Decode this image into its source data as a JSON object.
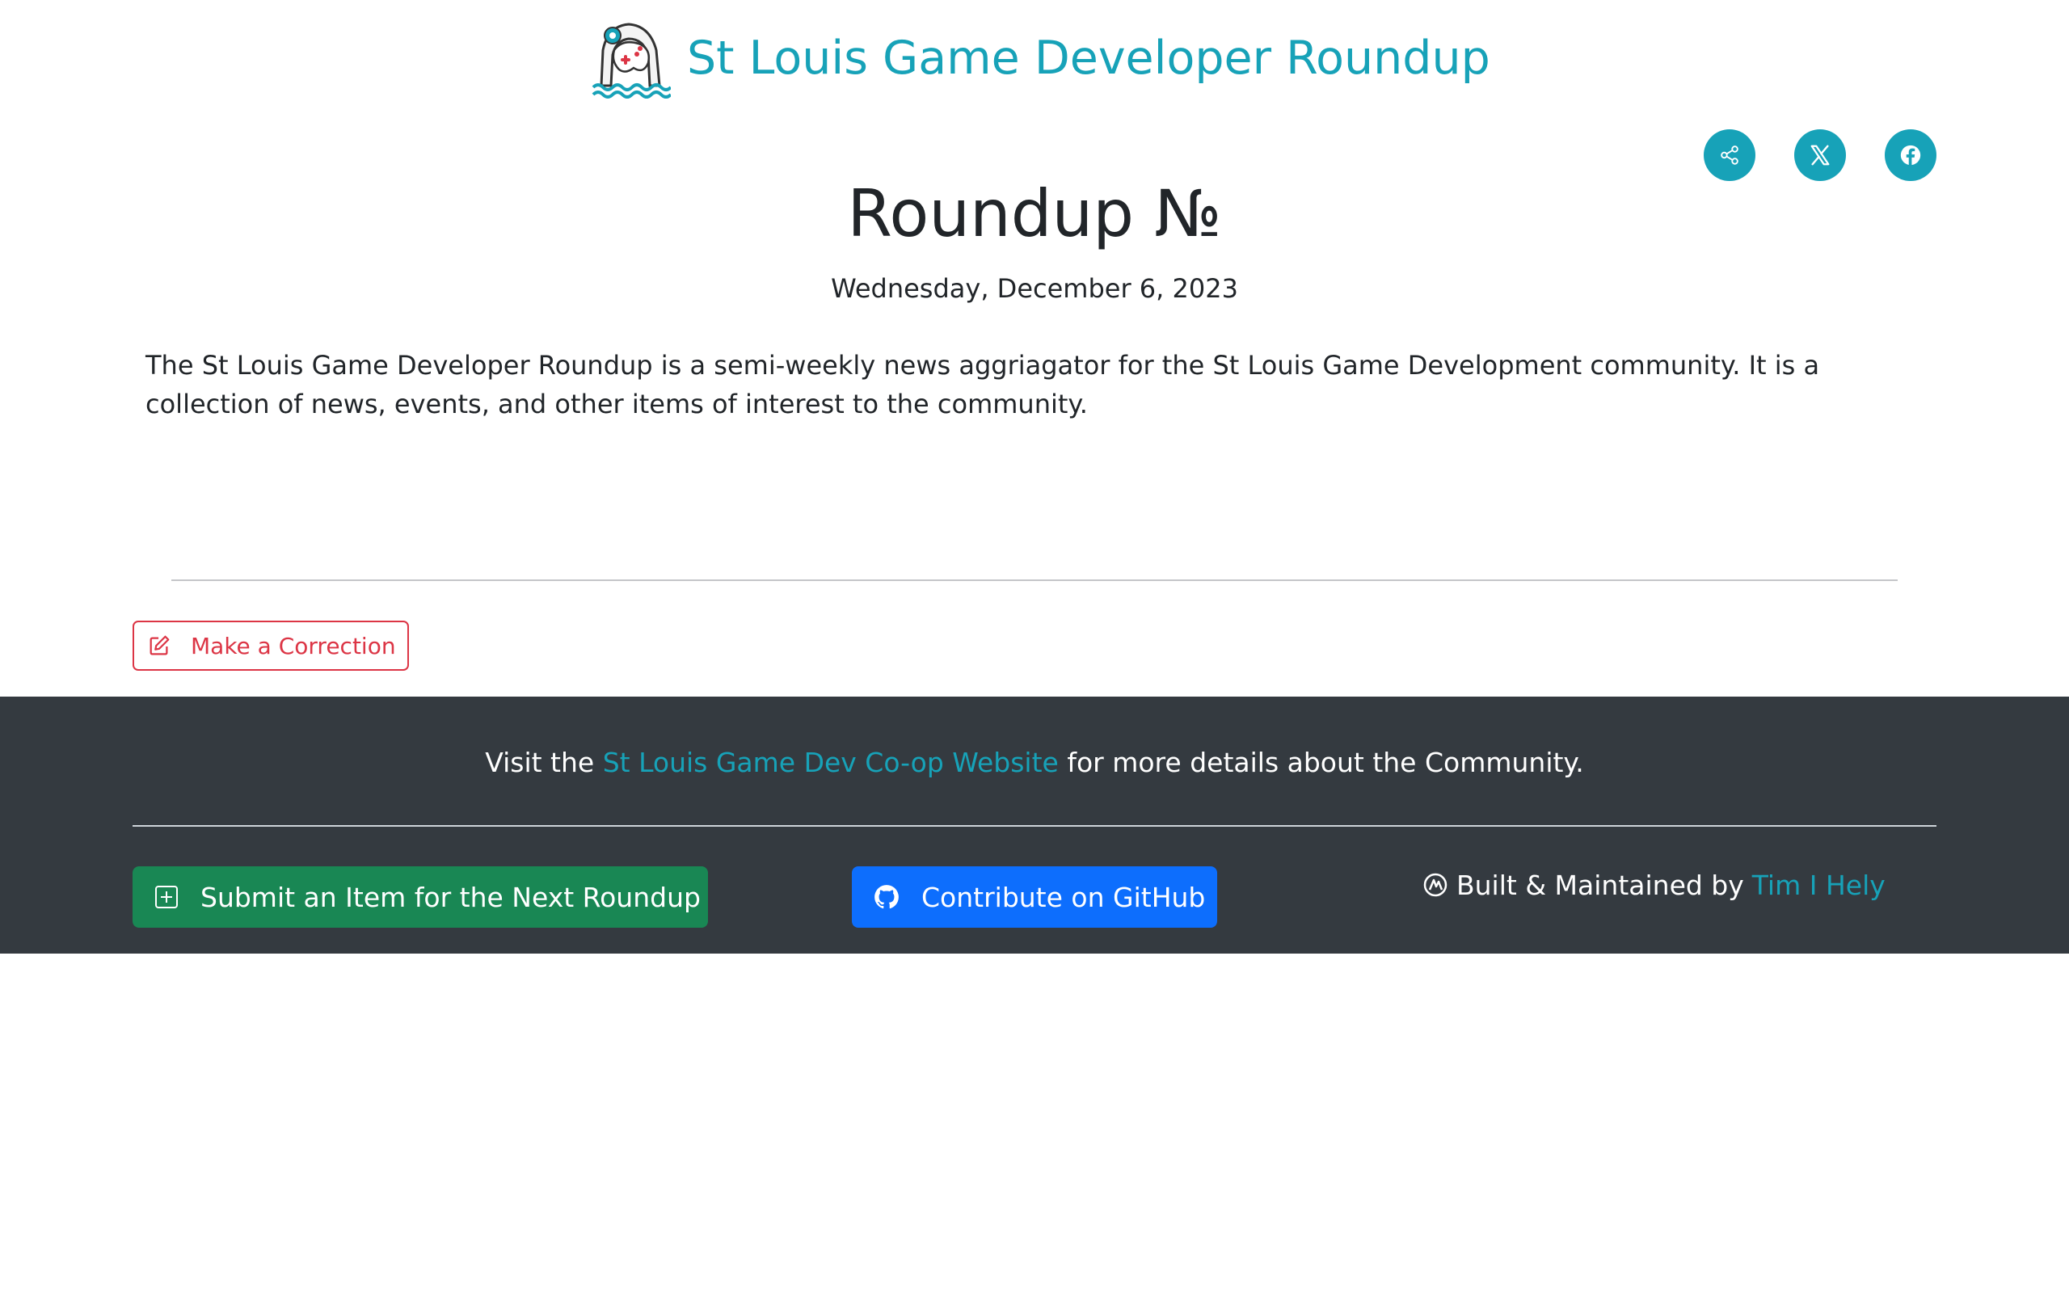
{
  "header": {
    "site_title": "St Louis Game Developer Roundup",
    "logo_icon": "arch-controller-logo-icon"
  },
  "share": {
    "buttons": [
      {
        "name": "share",
        "icon": "share-icon"
      },
      {
        "name": "x",
        "icon": "x-twitter-icon"
      },
      {
        "name": "facebook",
        "icon": "facebook-icon"
      }
    ],
    "color": "#17a2b8"
  },
  "main": {
    "title": "Roundup №",
    "date": "Wednesday, December 6, 2023",
    "intro": "The St Louis Game Developer Roundup is a semi-weekly news aggriagator for the St Louis Game Development community. It is a collection of news, events, and other items of interest to the community.",
    "correction_label": "Make a Correction"
  },
  "footer": {
    "visit_prefix": "Visit the",
    "visit_link": "St Louis Game Dev Co-op Website",
    "visit_suffix": "for more details about the Community.",
    "submit_label": "Submit an Item for the Next Roundup",
    "github_label": "Contribute on GitHub",
    "built_by_prefix": "Built & Maintained by",
    "author": "Tim I Hely"
  },
  "colors": {
    "accent": "#17a2b8",
    "danger": "#dc3545",
    "success": "#198754",
    "primary": "#0d6efd",
    "footer_bg": "#343a40"
  }
}
